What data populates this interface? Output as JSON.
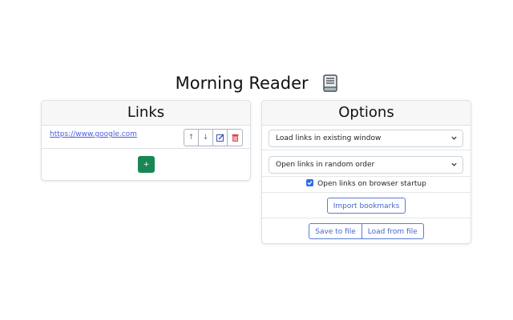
{
  "app": {
    "title": "Morning Reader",
    "icon": "book-icon"
  },
  "links": {
    "header": "Links",
    "items": [
      {
        "url": "https://www.google.com"
      }
    ],
    "row_actions": [
      "move-up-icon",
      "move-down-icon",
      "edit-icon",
      "delete-icon"
    ],
    "row_action_glyphs": {
      "up": "↑",
      "down": "↓"
    },
    "add_label": "+",
    "add_color": "#198754"
  },
  "options": {
    "header": "Options",
    "window_select": {
      "value": "Load links in existing window"
    },
    "order_select": {
      "value": "Open links in random order"
    },
    "startup_checkbox": {
      "label": "Open links on browser startup",
      "checked": true
    },
    "import_label": "Import bookmarks",
    "save_label": "Save to file",
    "load_label": "Load from file",
    "accent_color": "#2f6ee6"
  }
}
